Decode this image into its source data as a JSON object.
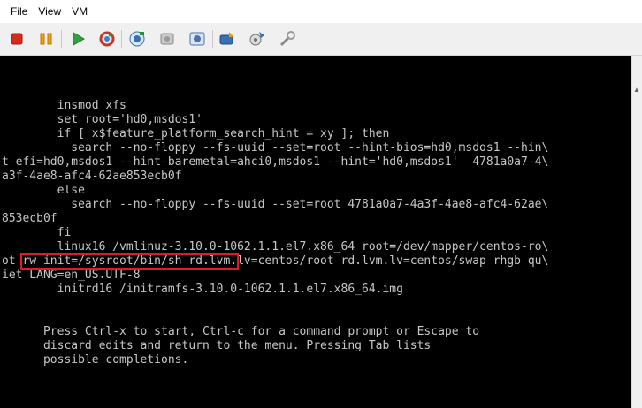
{
  "menu": {
    "file": "File",
    "view": "View",
    "vm": "VM"
  },
  "toolbar": {
    "icons": [
      "stop-icon",
      "pause-icon",
      "play-icon",
      "reset-icon",
      "snapshot-icon",
      "revert-icon",
      "manage-snapshots-icon",
      "send-keys-icon",
      "settings-icon",
      "tools-icon"
    ],
    "colors": {
      "stop": "#d62a1e",
      "pause": "#f0a10b",
      "play": "#2ea340",
      "reset": "#c0392b"
    }
  },
  "console": {
    "lines": [
      "        insmod xfs",
      "        set root='hd0,msdos1'",
      "        if [ x$feature_platform_search_hint = xy ]; then",
      "          search --no-floppy --fs-uuid --set=root --hint-bios=hd0,msdos1 --hin\\",
      "t-efi=hd0,msdos1 --hint-baremetal=ahci0,msdos1 --hint='hd0,msdos1'  4781a0a7-4\\",
      "a3f-4ae8-afc4-62ae853ecb0f",
      "        else",
      "          search --no-floppy --fs-uuid --set=root 4781a0a7-4a3f-4ae8-afc4-62ae\\",
      "853ecb0f",
      "        fi",
      "        linux16 /vmlinuz-3.10.0-1062.1.1.el7.x86_64 root=/dev/mapper/centos-ro\\",
      "ot rw init=/sysroot/bin/sh rd.lvm.lv=centos/root rd.lvm.lv=centos/swap rhgb qu\\",
      "iet LANG=en_US.UTF-8",
      "        initrd16 /initramfs-3.10.0-1062.1.1.el7.x86_64.img",
      "",
      "",
      "      Press Ctrl-x to start, Ctrl-c for a command prompt or Escape to",
      "      discard edits and return to the menu. Pressing Tab lists",
      "      possible completions."
    ],
    "highlight_color": "#e2192c"
  }
}
